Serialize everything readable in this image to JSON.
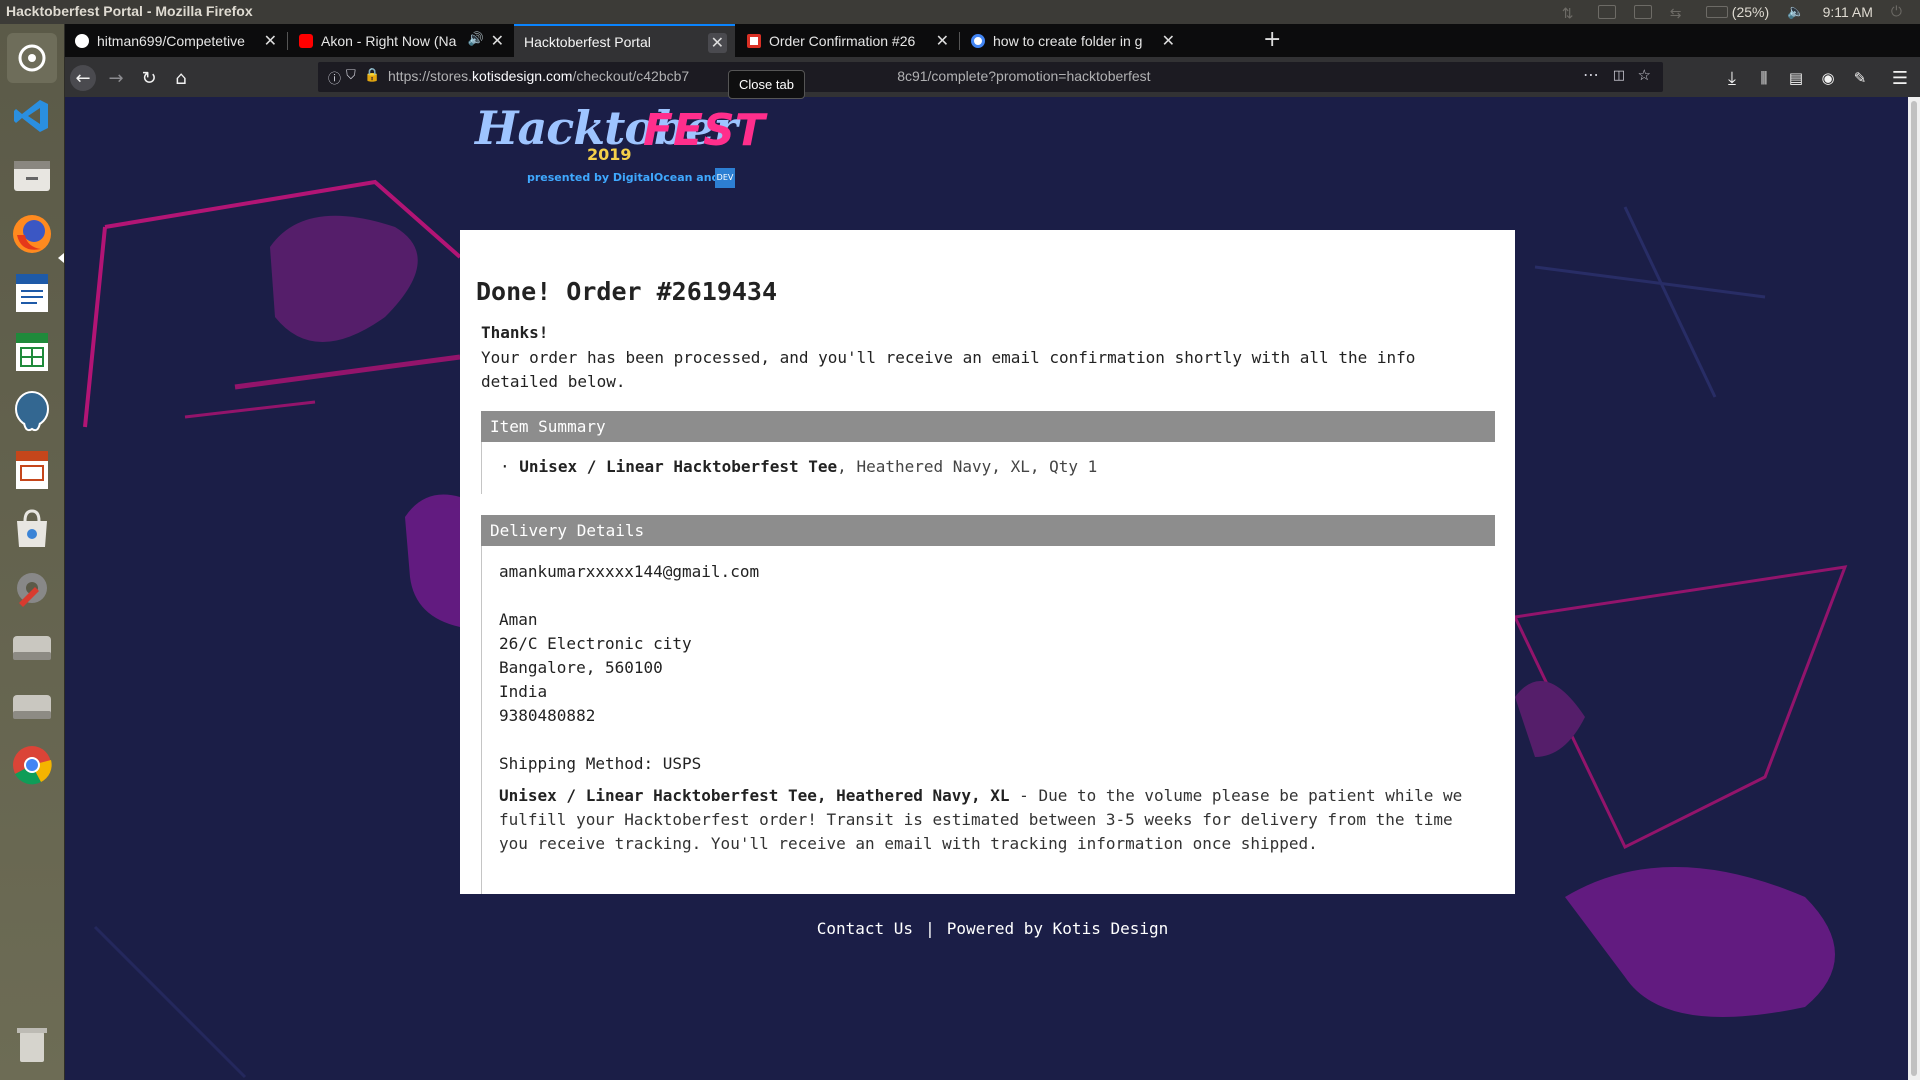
{
  "window": {
    "title": "Hacktoberfest Portal - Mozilla Firefox"
  },
  "tray": {
    "battery": "(25%)",
    "time": "9:11 AM"
  },
  "launcher": [
    {
      "name": "dash-home-icon"
    },
    {
      "name": "vscode-icon"
    },
    {
      "name": "files-icon"
    },
    {
      "name": "firefox-icon"
    },
    {
      "name": "writer-icon"
    },
    {
      "name": "calc-icon"
    },
    {
      "name": "pgadmin-icon"
    },
    {
      "name": "impress-icon"
    },
    {
      "name": "software-center-icon"
    },
    {
      "name": "settings-icon"
    },
    {
      "name": "drive-icon"
    },
    {
      "name": "drive-2-icon"
    },
    {
      "name": "chrome-icon"
    },
    {
      "name": "trash-icon"
    }
  ],
  "tabs": [
    {
      "title": "hitman699/Competetive",
      "active": false
    },
    {
      "title": "Akon - Right Now (Na",
      "active": false
    },
    {
      "title": "Hacktoberfest Portal",
      "active": true
    },
    {
      "title": "Order Confirmation #26",
      "active": false
    },
    {
      "title": "how to create folder in g",
      "active": false
    }
  ],
  "tooltip": "Close tab",
  "url": {
    "prefix": "https://stores.",
    "domain": "kotisdesign.com",
    "path": "/checkout/c42bcb7",
    "path_end": "8c91/complete?promotion=hacktoberfest"
  },
  "logo": {
    "wordmark": "Hacktober",
    "wordmark2": "FEST",
    "year": "2019",
    "presented": "presented by  DigitalOcean  and",
    "dev": "DEV"
  },
  "order": {
    "title": "Done! Order #2619434",
    "thanks": "Thanks!",
    "message": "Your order has been processed, and you'll receive an email confirmation shortly with all the info detailed below.",
    "item_summary_label": "Item Summary",
    "item_bullet": "·",
    "item_name": "Unisex / Linear Hacktoberfest Tee",
    "item_details": ", Heathered Navy, XL, Qty 1",
    "delivery_label": "Delivery Details",
    "email": "amankumarxxxxx144@gmail.com",
    "address": [
      "Aman",
      "26/C Electronic city",
      "Bangalore, 560100",
      "India",
      "9380480882"
    ],
    "shipping_method": "Shipping Method: USPS",
    "note_item": "Unisex / Linear Hacktoberfest Tee, Heathered Navy, XL",
    "note_text": " - Due to the volume please be patient while we fulfill your Hacktoberfest order! Transit is estimated between 3-5 weeks for delivery from the time you receive tracking. You'll receive an email with tracking information once shipped."
  },
  "footer": {
    "contact": "Contact Us",
    "separator": "|",
    "powered": "Powered by Kotis Design"
  },
  "colors": {
    "page_bg": "#1b1e47",
    "accent_pink": "#ff2e8c",
    "section_head": "#8d8d8d"
  }
}
